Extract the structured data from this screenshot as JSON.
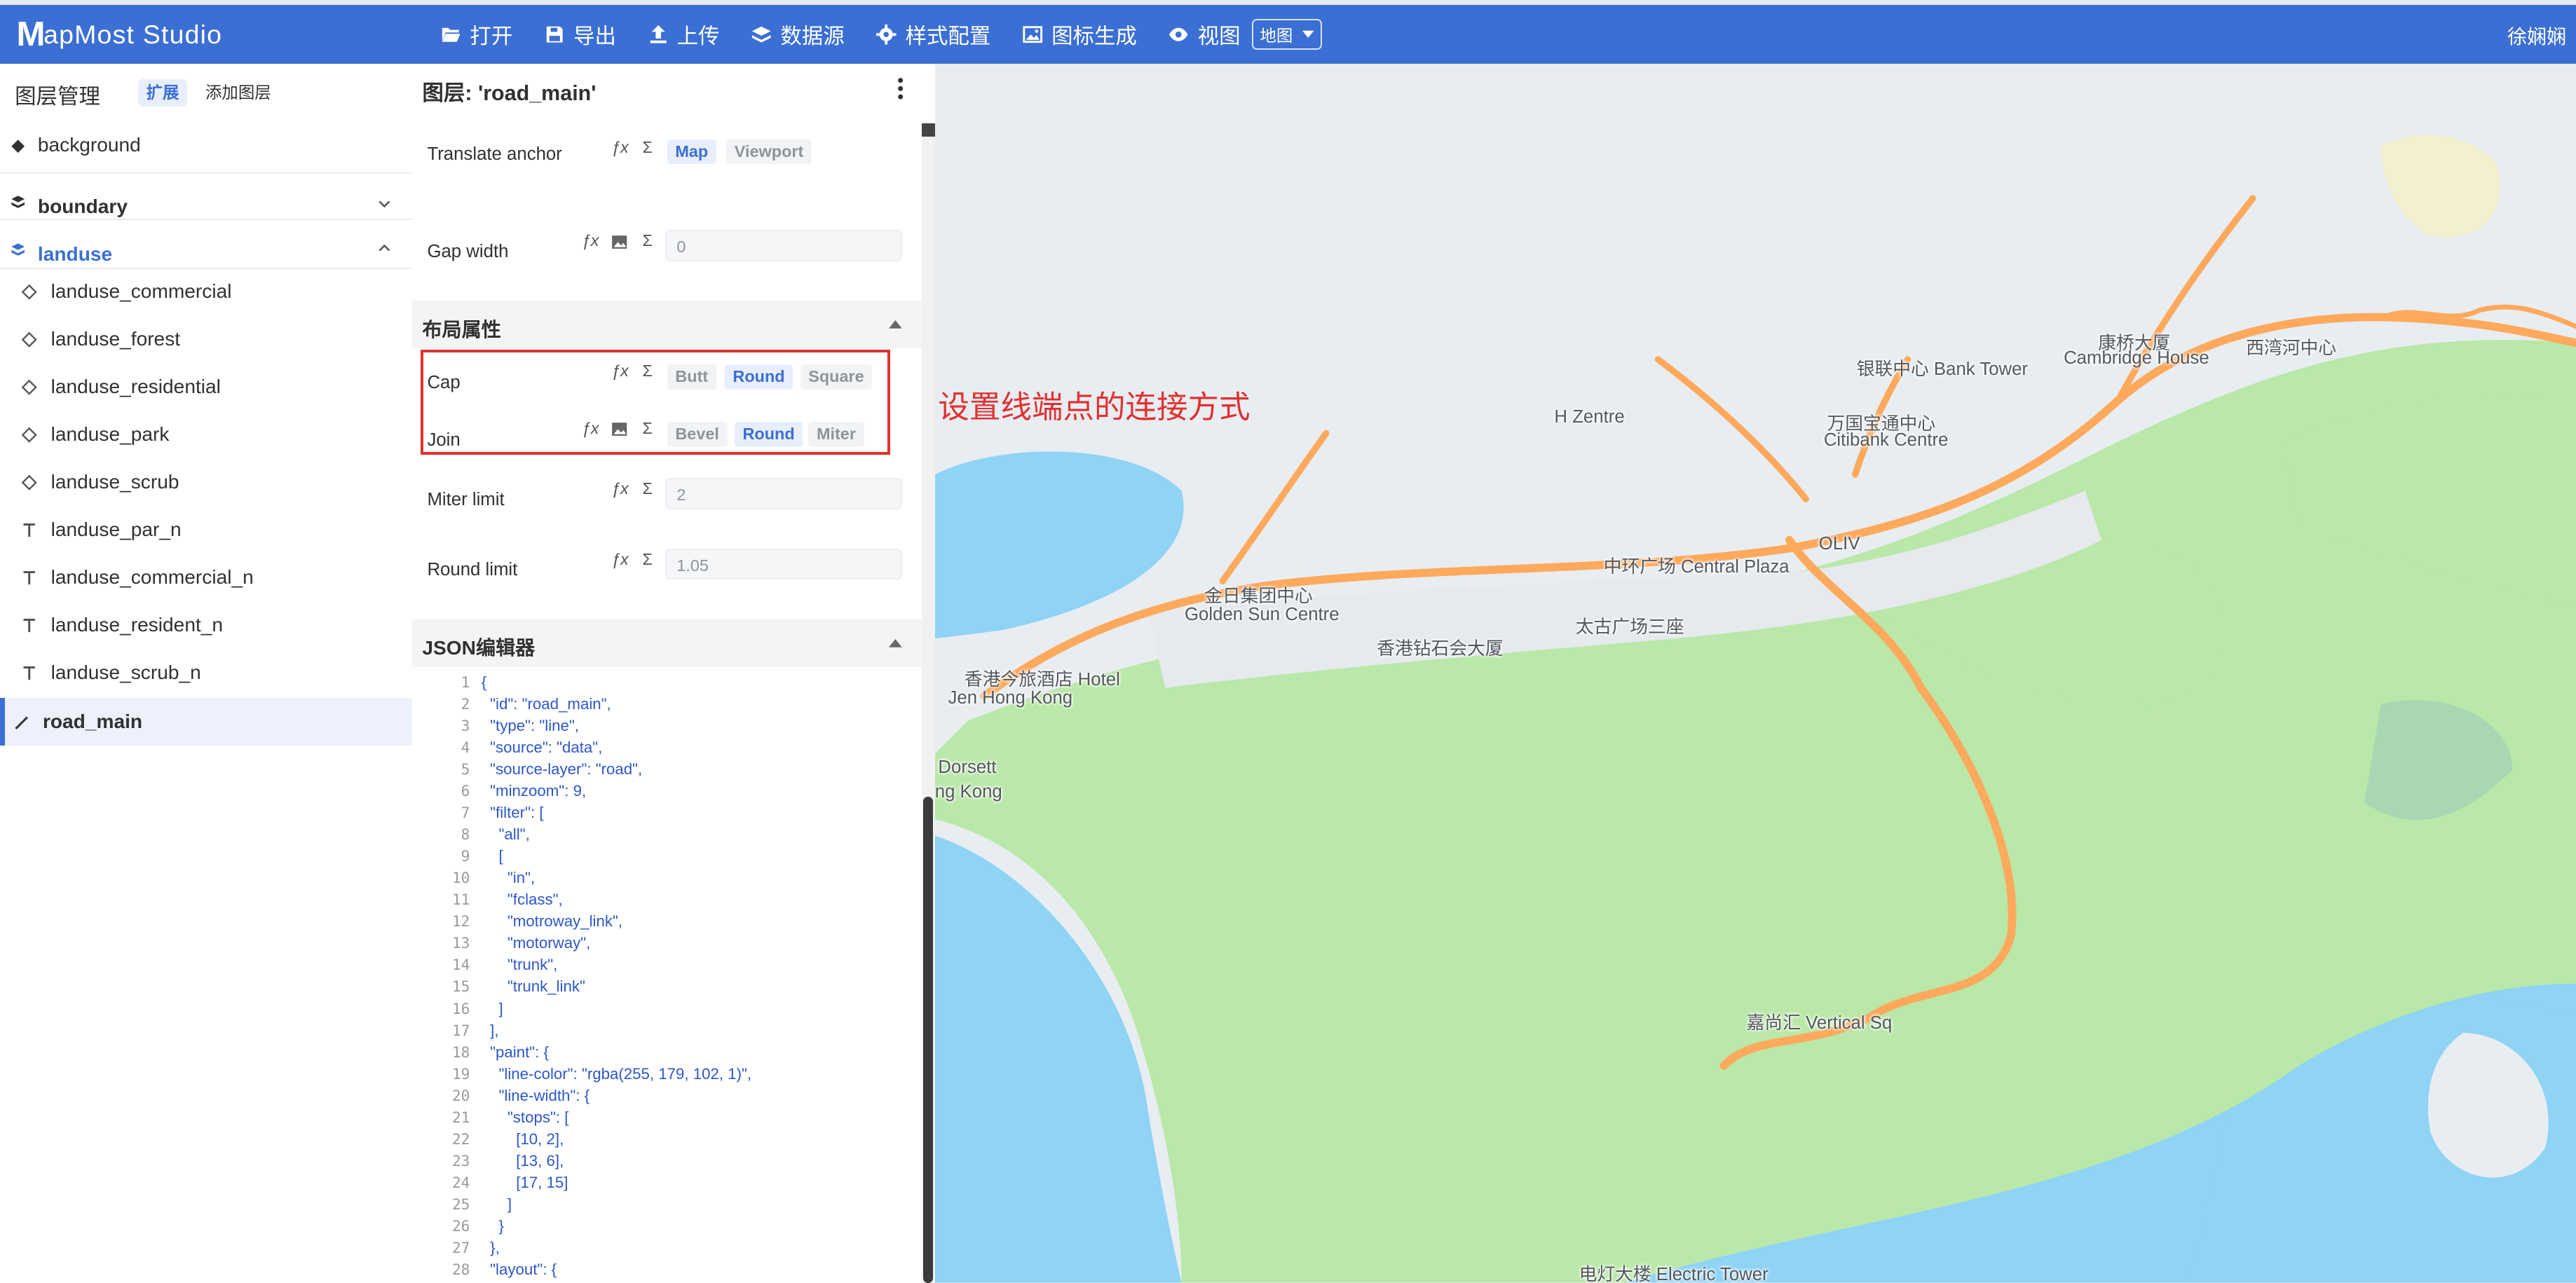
{
  "app": {
    "logo_m": "M",
    "logo_text": "apMost",
    "logo_studio": "Studio",
    "user": "徐娴娴"
  },
  "menu": [
    {
      "label": "打开",
      "icon": "folder-open-icon"
    },
    {
      "label": "导出",
      "icon": "save-icon"
    },
    {
      "label": "上传",
      "icon": "upload-icon"
    },
    {
      "label": "数据源",
      "icon": "layers-icon"
    },
    {
      "label": "样式配置",
      "icon": "gear-icon"
    },
    {
      "label": "图标生成",
      "icon": "image-icon"
    },
    {
      "label": "视图",
      "icon": "eye-icon"
    }
  ],
  "view_select": {
    "value": "地图"
  },
  "layer_panel": {
    "title": "图层管理",
    "expand_label": "扩展",
    "add_label": "添加图层",
    "layers": [
      {
        "name": "background",
        "type": "fill-group"
      },
      {
        "name": "boundary",
        "type": "group",
        "expanded": false
      },
      {
        "name": "landuse",
        "type": "group",
        "expanded": true
      },
      {
        "name": "landuse_commercial",
        "type": "fill"
      },
      {
        "name": "landuse_forest",
        "type": "fill"
      },
      {
        "name": "landuse_residential",
        "type": "fill"
      },
      {
        "name": "landuse_park",
        "type": "fill"
      },
      {
        "name": "landuse_scrub",
        "type": "fill"
      },
      {
        "name": "landuse_par_n",
        "type": "symbol"
      },
      {
        "name": "landuse_commercial_n",
        "type": "symbol"
      },
      {
        "name": "landuse_resident_n",
        "type": "symbol"
      },
      {
        "name": "landuse_scrub_n",
        "type": "symbol"
      },
      {
        "name": "road_main",
        "type": "line",
        "selected": true
      }
    ]
  },
  "props": {
    "title": "图层: 'road_main'",
    "translate_anchor": {
      "label": "Translate anchor",
      "options": [
        "Map",
        "Viewport"
      ],
      "selected": "Map"
    },
    "gap_width": {
      "label": "Gap width",
      "value": "0"
    },
    "layout_section": "布局属性",
    "cap": {
      "label": "Cap",
      "options": [
        "Butt",
        "Round",
        "Square"
      ],
      "selected": "Round"
    },
    "join": {
      "label": "Join",
      "options": [
        "Bevel",
        "Round",
        "Miter"
      ],
      "selected": "Round"
    },
    "miter_limit": {
      "label": "Miter limit",
      "value": "2"
    },
    "round_limit": {
      "label": "Round limit",
      "value": "1.05"
    },
    "json_section": "JSON编辑器",
    "fx": "ƒx",
    "sigma": "Σ"
  },
  "annotation": "设置线端点的连接方式",
  "json_lines": [
    "{",
    "  \"id\": \"road_main\",",
    "  \"type\": \"line\",",
    "  \"source\": \"data\",",
    "  \"source-layer\": \"road\",",
    "  \"minzoom\": 9,",
    "  \"filter\": [",
    "    \"all\",",
    "    [",
    "      \"in\",",
    "      \"fclass\",",
    "      \"motroway_link\",",
    "      \"motorway\",",
    "      \"trunk\",",
    "      \"trunk_link\"",
    "    ]",
    "  ],",
    "  \"paint\": {",
    "    \"line-color\": \"rgba(255, 179, 102, 1)\",",
    "    \"line-width\": {",
    "      \"stops\": [",
    "        [10, 2],",
    "        [13, 6],",
    "        [17, 15]",
    "      ]",
    "    }",
    "  },",
    "  \"layout\": {"
  ],
  "map_labels": [
    "银联中心 Bank Tower",
    "康桥大厦",
    "Cambridge House",
    "西湾河中心",
    "H Zentre",
    "万国宝通中心",
    "Citibank Centre",
    "OLIV",
    "中环广场 Central Plaza",
    "太古广场三座",
    "香港钻石会大厦",
    "金日集团中心",
    "Golden Sun Centre",
    "香港今旅酒店 Hotel",
    "Jen Hong Kong",
    "Dorsett",
    "ng Kong",
    "嘉尚汇 Vertical Sq",
    "电灯大楼 Electric Tower"
  ],
  "colors": {
    "topbar": "#3b6fd4",
    "accent": "#3b6fd4",
    "road": "#ffa95c",
    "water": "#8fd3f5",
    "green": "#b9e8a8",
    "annotation": "#e0312f"
  }
}
